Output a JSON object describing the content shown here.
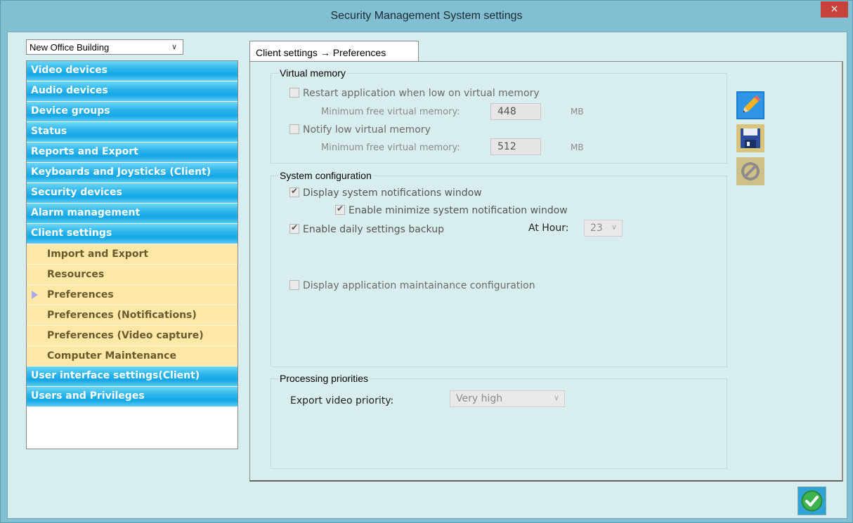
{
  "window": {
    "title": "Security Management System settings",
    "close_label": "×"
  },
  "building_select": {
    "value": "New Office Building"
  },
  "nav": {
    "items": [
      {
        "label": "Video devices"
      },
      {
        "label": "Audio devices"
      },
      {
        "label": "Device groups"
      },
      {
        "label": "Status"
      },
      {
        "label": "Reports and Export"
      },
      {
        "label": "Keyboards and Joysticks (Client)"
      },
      {
        "label": "Security devices"
      },
      {
        "label": "Alarm management"
      },
      {
        "label": "Client settings"
      }
    ],
    "sub_items": [
      {
        "label": "Import and Export"
      },
      {
        "label": "Resources"
      },
      {
        "label": "Preferences"
      },
      {
        "label": "Preferences (Notifications)"
      },
      {
        "label": "Preferences (Video capture)"
      },
      {
        "label": "Computer Maintenance"
      }
    ],
    "items_after": [
      {
        "label": "User interface settings(Client)"
      },
      {
        "label": "Users and Privileges"
      }
    ]
  },
  "tab": {
    "label": "Client settings → Preferences"
  },
  "virtual_memory": {
    "title": "Virtual memory",
    "restart_label": "Restart application when low on virtual memory",
    "min_free_label_1": "Minimum free virtual memory:",
    "min_free_value_1": "448",
    "unit_1": "MB",
    "notify_label": "Notify low virtual memory",
    "min_free_label_2": "Minimum free virtual memory:",
    "min_free_value_2": "512",
    "unit_2": "MB"
  },
  "system_config": {
    "title": "System configuration",
    "display_notifications_label": "Display system notifications window",
    "enable_minimize_label": "Enable minimize system notification window",
    "daily_backup_label": "Enable daily settings backup",
    "at_hour_label": "At Hour:",
    "at_hour_value": "23",
    "maintenance_label": "Display application maintainance configuration"
  },
  "processing": {
    "title": "Processing priorities",
    "export_priority_label": "Export video priority:",
    "export_priority_value": "Very high"
  },
  "icons": {
    "edit": "pencil-icon",
    "save": "floppy-disk-icon",
    "cancel": "forbidden-icon",
    "ok": "checkmark-icon"
  },
  "colors": {
    "nav_item": "#14a6e6",
    "sub_item_bg": "#fde8a8",
    "sub_item_text": "#6b5a2b",
    "close_button": "#c7433a",
    "ok_green": "#3fb34f"
  }
}
